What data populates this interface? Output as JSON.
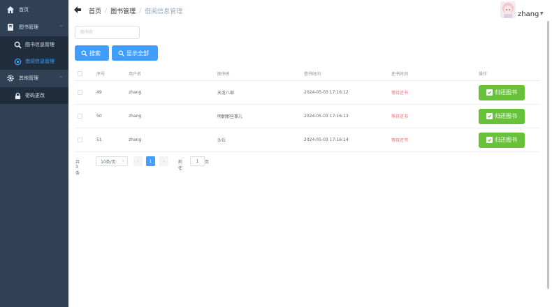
{
  "sidebar": {
    "home": "首页",
    "book_mgmt": "图书管理",
    "book_info": "图书信息管理",
    "borrow_info": "借阅信息管理",
    "other_mgmt": "其他管理",
    "password_change": "密码更改"
  },
  "header": {
    "breadcrumb": [
      "首页",
      "图书管理",
      "借阅信息管理"
    ],
    "separator": "/",
    "username": "zhang"
  },
  "search": {
    "placeholder": "图书名",
    "search_button": "搜索",
    "show_all_button": "显示全部"
  },
  "table": {
    "columns": [
      "序号",
      "用户名",
      "图书名",
      "借书时间",
      "还书时间",
      "操作"
    ],
    "rows": [
      {
        "id": "49",
        "user": "zhang",
        "book": "天龙八部",
        "borrow_time": "2024-05-03 17:16:12",
        "return_status": "等待还书",
        "action": "归还图书"
      },
      {
        "id": "50",
        "user": "zhang",
        "book": "明朝那些事儿",
        "borrow_time": "2024-05-03 17:16:13",
        "return_status": "等待还书",
        "action": "归还图书"
      },
      {
        "id": "51",
        "user": "zhang",
        "book": "沙丘",
        "borrow_time": "2024-05-03 17:16:14",
        "return_status": "等待还书",
        "action": "归还图书"
      }
    ]
  },
  "pagination": {
    "total": "共 3 条",
    "page_size": "10条/页",
    "prev": "‹",
    "current_page": "1",
    "next": "›",
    "goto_label": "前往",
    "goto_value": "1",
    "page_suffix": "页"
  },
  "colors": {
    "sidebar_bg": "#304156",
    "primary": "#409eff",
    "success": "#67c23a",
    "danger": "#f56c6c"
  }
}
